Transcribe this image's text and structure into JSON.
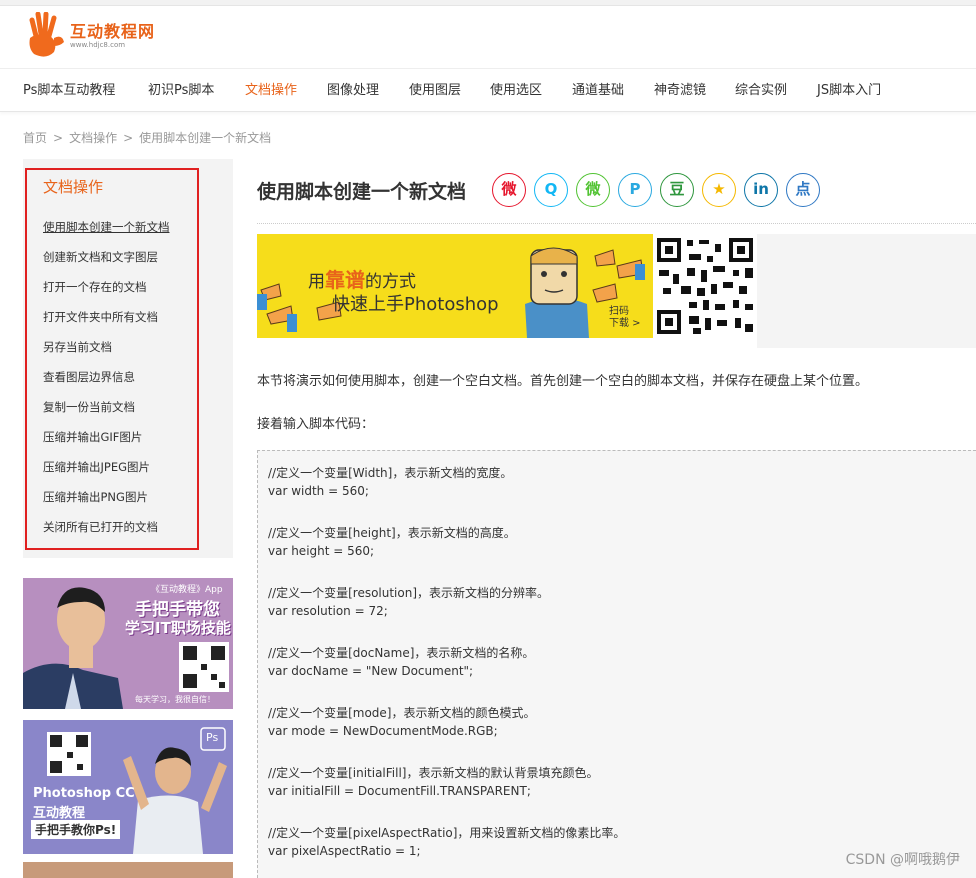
{
  "logo": {
    "text": "互动教程网",
    "url": "www.hdjc8.com"
  },
  "nav": {
    "items": [
      {
        "label": "Ps脚本互动教程"
      },
      {
        "label": "初识Ps脚本"
      },
      {
        "label": "文档操作",
        "active": true
      },
      {
        "label": "图像处理"
      },
      {
        "label": "使用图层"
      },
      {
        "label": "使用选区"
      },
      {
        "label": "通道基础"
      },
      {
        "label": "神奇滤镜"
      },
      {
        "label": "综合实例"
      },
      {
        "label": "JS脚本入门"
      }
    ]
  },
  "breadcrumb": {
    "home": "首页",
    "sep": ">",
    "section": "文档操作",
    "current": "使用脚本创建一个新文档"
  },
  "sidebar": {
    "title": "文档操作",
    "items": [
      "使用脚本创建一个新文档",
      "创建新文档和文字图层",
      "打开一个存在的文档",
      "打开文件夹中所有文档",
      "另存当前文档",
      "查看图层边界信息",
      "复制一份当前文档",
      "压缩并输出GIF图片",
      "压缩并输出JPEG图片",
      "压缩并输出PNG图片",
      "关闭所有已打开的文档"
    ]
  },
  "ads": {
    "ad1_line1": "《互动教程》App",
    "ad1_line2": "手把手带您",
    "ad1_line3": "学习IT职场技能",
    "ad1_footer": "每天学习，我很自信！",
    "ad2_line1": "Photoshop CC",
    "ad2_line2": "互动教程",
    "ad2_line3": "手把手教你Ps!",
    "ad2_badge": "Ps"
  },
  "article": {
    "title": "使用脚本创建一个新文档",
    "share_icons": [
      {
        "name": "weibo-icon",
        "glyph": "微",
        "color": "#e6162d"
      },
      {
        "name": "qq-icon",
        "glyph": "Q",
        "color": "#12b7f5"
      },
      {
        "name": "wechat-icon",
        "glyph": "微",
        "color": "#51c332"
      },
      {
        "name": "pinterest-icon",
        "glyph": "P",
        "color": "#2aa9e0"
      },
      {
        "name": "douban-icon",
        "glyph": "豆",
        "color": "#2e963d"
      },
      {
        "name": "qzone-icon",
        "glyph": "★",
        "color": "#f5b800"
      },
      {
        "name": "linkedin-icon",
        "glyph": "in",
        "color": "#0e76a8"
      },
      {
        "name": "dianping-icon",
        "glyph": "点",
        "color": "#2f78c4"
      }
    ],
    "banner": {
      "text_prefix": "用",
      "text_highlight": "靠谱",
      "text_suffix": "的方式",
      "line2": "快速上手Photoshop",
      "scan": "扫码",
      "download": "下载 >"
    },
    "intro": "本节将演示如何使用脚本，创建一个空白文档。首先创建一个空白的脚本文档，并保存在硬盘上某个位置。",
    "prompt": "接着输入脚本代码：",
    "code": [
      "//定义一个变量[Width]，表示新文档的宽度。",
      "var width = 560;",
      "",
      "//定义一个变量[height]，表示新文档的高度。",
      "var height = 560;",
      "",
      "//定义一个变量[resolution]，表示新文档的分辨率。",
      "var resolution = 72;",
      "",
      "//定义一个变量[docName]，表示新文档的名称。",
      "var docName = \"New Document\";",
      "",
      "//定义一个变量[mode]，表示新文档的颜色模式。",
      "var mode = NewDocumentMode.RGB;",
      "",
      "//定义一个变量[initialFill]，表示新文档的默认背景填充颜色。",
      "var initialFill = DocumentFill.TRANSPARENT;",
      "",
      "//定义一个变量[pixelAspectRatio]，用来设置新文档的像素比率。",
      "var pixelAspectRatio = 1;"
    ]
  },
  "watermark": "CSDN @啊哦鹅伊",
  "colors": {
    "accent": "#e8631a",
    "sidebar_outline": "#e02020",
    "banner_bg": "#f6dd1b"
  }
}
